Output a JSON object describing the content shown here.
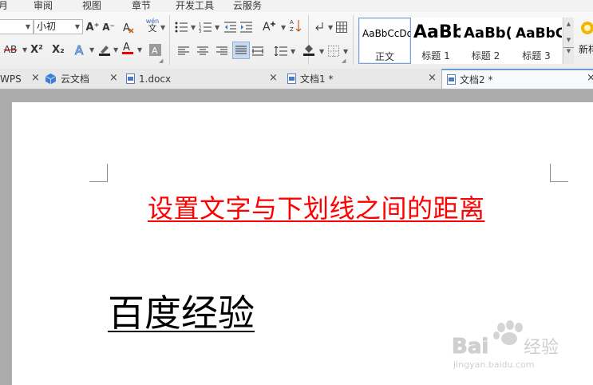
{
  "menubar": {
    "items": [
      "月",
      "审阅",
      "视图",
      "章节",
      "开发工具",
      "云服务"
    ]
  },
  "toolbar": {
    "font_size": "小初",
    "font_name": "",
    "grow_font": "A⁺",
    "shrink_font": "A⁻",
    "strikethrough": "AB",
    "superscript": "X²",
    "subscript": "X₂",
    "phonetic_label": "wén",
    "phonetic_char": "文"
  },
  "styles": [
    {
      "sample": "AaBbCcDd",
      "name": "正文"
    },
    {
      "sample": "AaBb",
      "name": "标题 1"
    },
    {
      "sample": "AaBb(",
      "name": "标题 2"
    },
    {
      "sample": "AaBbC",
      "name": "标题 3"
    }
  ],
  "new_style_label": "新样",
  "tabs": [
    {
      "label": "WPS",
      "icon": "wps-icon"
    },
    {
      "label": "云文档",
      "icon": "cloud-cube-icon"
    },
    {
      "label": "1.docx",
      "icon": "doc-icon"
    },
    {
      "label": "文档1 *",
      "icon": "doc-icon"
    },
    {
      "label": "文档2 *",
      "icon": "doc-icon",
      "active": true
    }
  ],
  "document": {
    "heading": "设置文字与下划线之间的距离",
    "subtitle": "百度经验"
  },
  "watermark": {
    "brand": "Baidu经验",
    "url": "jingyan.baidu.com"
  },
  "colors": {
    "heading": "#ff0000",
    "active_tab": "#ffffff",
    "accent_blue": "#3c78c8"
  }
}
